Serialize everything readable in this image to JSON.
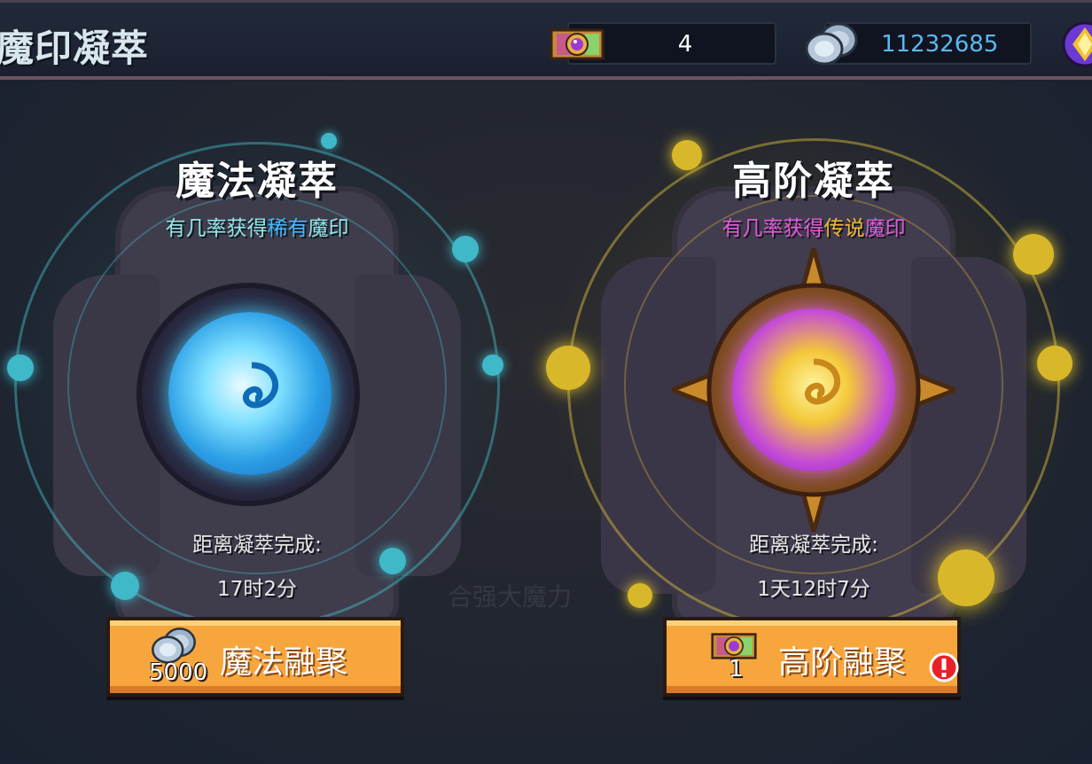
{
  "header": {
    "title": "魔印凝萃",
    "ticket_count": "4",
    "silver_count": "11232685"
  },
  "cards": [
    {
      "title": "魔法凝萃",
      "desc_prefix": "有几率获得",
      "desc_rarity": "稀有",
      "desc_suffix": "魔印",
      "timer_label": "距离凝萃完成:",
      "timer_value": "17时2分",
      "button_label": "魔法融聚",
      "cost": "5000",
      "accent": "#4fd0e0",
      "rarity_color": "#43b8ff"
    },
    {
      "title": "高阶凝萃",
      "desc_prefix": "有几率获得",
      "desc_rarity": "传说",
      "desc_suffix": "魔印",
      "timer_label": "距离凝萃完成:",
      "timer_value": "1天12时7分",
      "button_label": "高阶融聚",
      "cost": "1",
      "accent": "#e8c02a",
      "rarity_color": "#f0b830"
    }
  ],
  "background_text": "合强大魔力"
}
